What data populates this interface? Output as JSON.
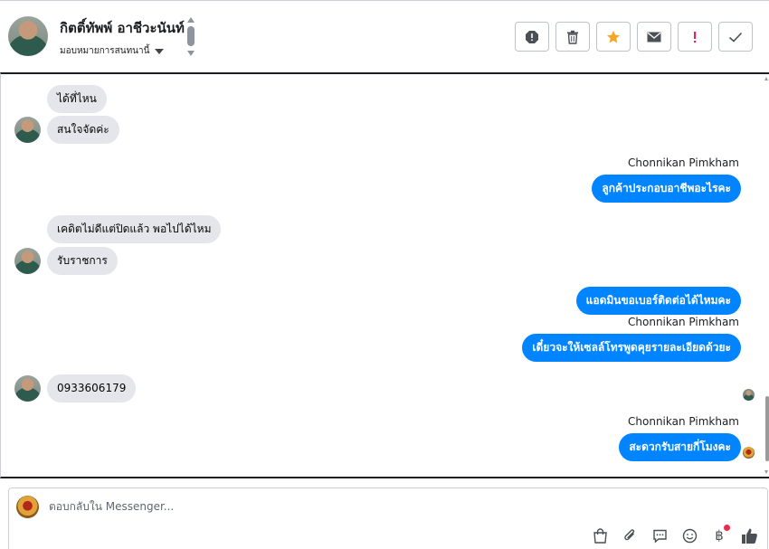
{
  "header": {
    "contact_name": "กิตติ์ทัพพ์ อาชีวะนันท์",
    "assign_label": "มอบหมายการสนทนานี้"
  },
  "toolbar": {
    "buttons": [
      {
        "icon": "octagon-alert-icon"
      },
      {
        "icon": "trash-icon"
      },
      {
        "icon": "star-icon"
      },
      {
        "icon": "envelope-icon"
      },
      {
        "icon": "exclamation-icon"
      },
      {
        "icon": "checkmark-icon"
      }
    ]
  },
  "messages": [
    {
      "from": "customer",
      "text": "ได้ที่ไหน"
    },
    {
      "from": "customer",
      "text": "สนใจจัดค่ะ"
    },
    {
      "from": "page",
      "sender": "Chonnikan Pimkham",
      "text": "ลูกค้าประกอบอาชีพอะไรคะ"
    },
    {
      "from": "customer",
      "text": "เคดิตไม่ดีแต่ปิดแล้ว พอไปได้ไหม"
    },
    {
      "from": "customer",
      "text": "รับราชการ"
    },
    {
      "from": "page",
      "text": "แอดมินขอเบอร์ติดต่อได้ไหมคะ"
    },
    {
      "from": "page",
      "sender": "Chonnikan Pimkham",
      "text": "เดี๋ยวจะให้เซลล์โทรพูดคุยรายละเอียดด้วยะ"
    },
    {
      "from": "customer",
      "text": "0933606179"
    },
    {
      "from": "page",
      "sender": "Chonnikan Pimkham",
      "text": "สะดวกรับสายกี่โมงคะ"
    }
  ],
  "composer": {
    "placeholder": "ตอบกลับใน Messenger...",
    "tools": [
      "bag-icon",
      "paperclip-icon",
      "saved-reply-icon",
      "emoji-icon",
      "baht-icon",
      "thumbs-up-icon"
    ],
    "baht_symbol": "฿"
  },
  "colors": {
    "outgoing_bubble": "#0084ff",
    "incoming_bubble": "#e4e6eb",
    "star": "#f5a623",
    "exclamation": "#e0245e",
    "notification_dot": "#f02849"
  }
}
